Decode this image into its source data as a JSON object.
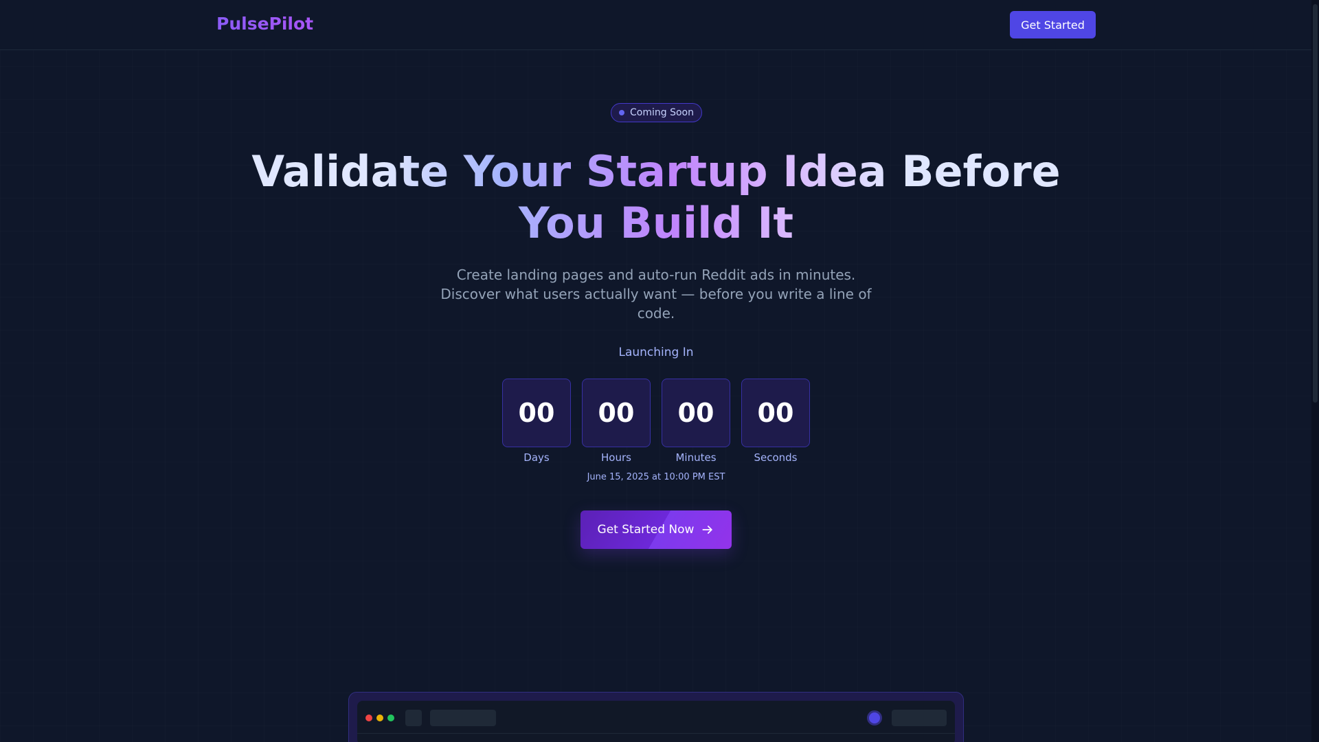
{
  "header": {
    "logo": "PulsePilot",
    "cta_label": "Get Started"
  },
  "hero": {
    "badge": "Coming Soon",
    "headline": "Validate Your Startup Idea Before You Build It",
    "subtitle": "Create landing pages and auto-run Reddit ads in minutes. Discover what users actually want — before you write a line of code.",
    "launch_label": "Launching In",
    "countdown": [
      {
        "value": "00",
        "label": "Days"
      },
      {
        "value": "00",
        "label": "Hours"
      },
      {
        "value": "00",
        "label": "Minutes"
      },
      {
        "value": "00",
        "label": "Seconds"
      }
    ],
    "launch_date": "June 15, 2025 at 10:00 PM EST",
    "cta_label": "Get Started Now",
    "cta_icon": "arrow-right-icon"
  },
  "colors": {
    "background": "#0f172a",
    "accent": "#4f46e5",
    "accent_purple": "#9333ea",
    "countdown_box": "#1e1b4b"
  }
}
